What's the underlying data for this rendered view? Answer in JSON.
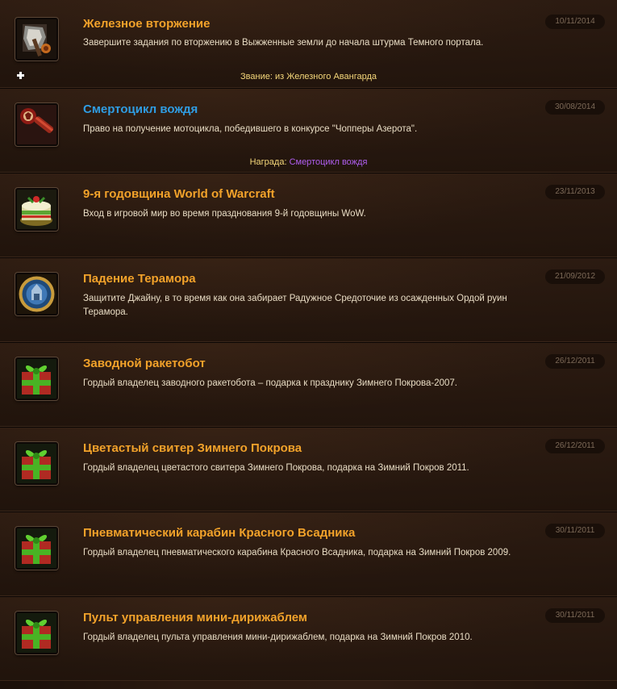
{
  "achievements": [
    {
      "title": "Железное вторжение",
      "description": "Завершите задания по вторжению в Выжженные земли до начала штурма Темного портала.",
      "date": "10/11/2014",
      "icon": "axe-icon",
      "reward_text": "Звание: из Железного Авангарда",
      "has_expand": true
    },
    {
      "title": "Смертоцикл вождя",
      "description": "Право на получение мотоцикла, победившего в конкурсе \"Чопперы Азерота\".",
      "date": "30/08/2014",
      "icon": "horde-key-icon",
      "reward_label": "Награда: ",
      "reward_item": "Смертоцикл вождя",
      "title_color": "#2f9de3"
    },
    {
      "title": "9-я годовщина World of Warcraft",
      "description": "Вход в игровой мир во время празднования 9-й годовщины WoW.",
      "date": "23/11/2013",
      "icon": "cake-icon"
    },
    {
      "title": "Падение Терамора",
      "description": "Защитите Джайну, в то время как она забирает Радужное Средоточие из осажденных Ордой руин Терамора.",
      "date": "21/09/2012",
      "icon": "theramore-crest-icon"
    },
    {
      "title": "Заводной ракетобот",
      "description": "Гордый владелец заводного ракетобота – подарка к празднику Зимнего Покрова-2007.",
      "date": "26/12/2011",
      "icon": "gift-box-icon"
    },
    {
      "title": "Цветастый свитер Зимнего Покрова",
      "description": "Гордый владелец цветастого свитера Зимнего Покрова, подарка на Зимний Покров 2011.",
      "date": "26/12/2011",
      "icon": "gift-box-icon"
    },
    {
      "title": "Пневматический карабин Красного Всадника",
      "description": "Гордый владелец пневматического карабина Красного Всадника, подарка на Зимний Покров 2009.",
      "date": "30/11/2011",
      "icon": "gift-box-icon"
    },
    {
      "title": "Пульт управления мини-дирижаблем",
      "description": "Гордый владелец пульта управления мини-дирижаблем, подарка на Зимний Покров 2010.",
      "date": "30/11/2011",
      "icon": "gift-box-icon"
    }
  ],
  "colors": {
    "title": "#f2a22a",
    "title_blue": "#2f9de3",
    "reward_item": "#b05ef0",
    "reward_label": "#f5d77a"
  }
}
